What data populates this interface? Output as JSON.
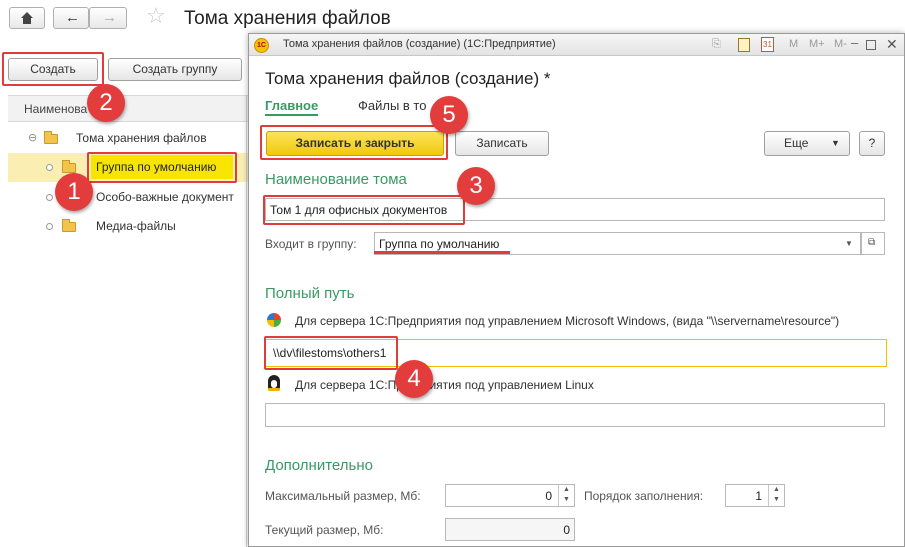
{
  "page": {
    "title": "Тома хранения файлов",
    "create_label": "Создать",
    "create_group_label": "Создать группу",
    "column_name": "Наименова",
    "tree": {
      "root": "Тома хранения файлов",
      "items": [
        "Группа по умолчанию",
        "Особо-важные документ",
        "Медиа-файлы"
      ]
    }
  },
  "window": {
    "titlebar": "Тома хранения файлов (создание)  (1С:Предприятие)",
    "titlebar_buttons": [
      "M",
      "M+",
      "M-"
    ],
    "heading": "Тома хранения файлов (создание) *",
    "tabs": [
      "Главное",
      "Файлы в то"
    ],
    "save_close_label": "Записать и закрыть",
    "save_label": "Записать",
    "more_label": "Еще",
    "help_label": "?",
    "section_name": "Наименование тома",
    "name_value": "Том 1 для офисных документов",
    "group_label": "Входит в группу:",
    "group_value": "Группа по умолчанию",
    "section_path": "Полный путь",
    "windows_hint": "Для сервера 1С:Предприятия под управлением Microsoft Windows, (вида \"\\\\servername\\resource\")",
    "windows_path": "\\\\dv\\filestoms\\others1",
    "linux_hint": "Для сервера 1С:Предприятия под управлением Linux",
    "linux_path": "",
    "section_extra": "Дополнительно",
    "max_size_label": "Максимальный размер, Мб:",
    "max_size_value": "0",
    "fill_order_label": "Порядок заполнения:",
    "fill_order_value": "1",
    "current_size_label": "Текущий размер, Мб:",
    "current_size_value": "0"
  },
  "badges": [
    "1",
    "2",
    "3",
    "4",
    "5"
  ],
  "colors": {
    "accent_green": "#3a9a64",
    "callout_red": "#e03c3c",
    "primary_yellow": "#f7d52c"
  }
}
